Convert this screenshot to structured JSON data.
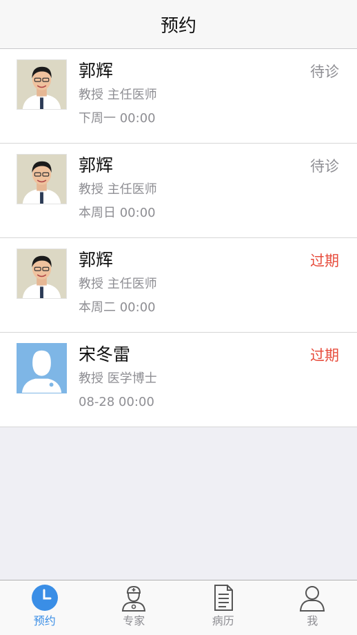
{
  "nav": {
    "title": "预约"
  },
  "colors": {
    "pending": "#8e8e93",
    "expired": "#e74c3c",
    "accent": "#3a8ee6",
    "placeholder_avatar": "#7eb6e6"
  },
  "appointments": [
    {
      "name": "郭辉",
      "title": "教授 主任医师",
      "time": "下周一 00:00",
      "status": "待诊",
      "status_type": "pending",
      "avatar": "doctor-photo"
    },
    {
      "name": "郭辉",
      "title": "教授 主任医师",
      "time": "本周日 00:00",
      "status": "待诊",
      "status_type": "pending",
      "avatar": "doctor-photo"
    },
    {
      "name": "郭辉",
      "title": "教授 主任医师",
      "time": "本周二 00:00",
      "status": "过期",
      "status_type": "expired",
      "avatar": "doctor-photo"
    },
    {
      "name": "宋冬雷",
      "title": "教授 医学博士",
      "time": "08-28 00:00",
      "status": "过期",
      "status_type": "expired",
      "avatar": "default-avatar"
    }
  ],
  "tabbar": {
    "items": [
      {
        "label": "预约",
        "icon": "clock-icon",
        "active": true
      },
      {
        "label": "专家",
        "icon": "nurse-icon",
        "active": false
      },
      {
        "label": "病历",
        "icon": "document-icon",
        "active": false
      },
      {
        "label": "我",
        "icon": "user-icon",
        "active": false
      }
    ]
  }
}
